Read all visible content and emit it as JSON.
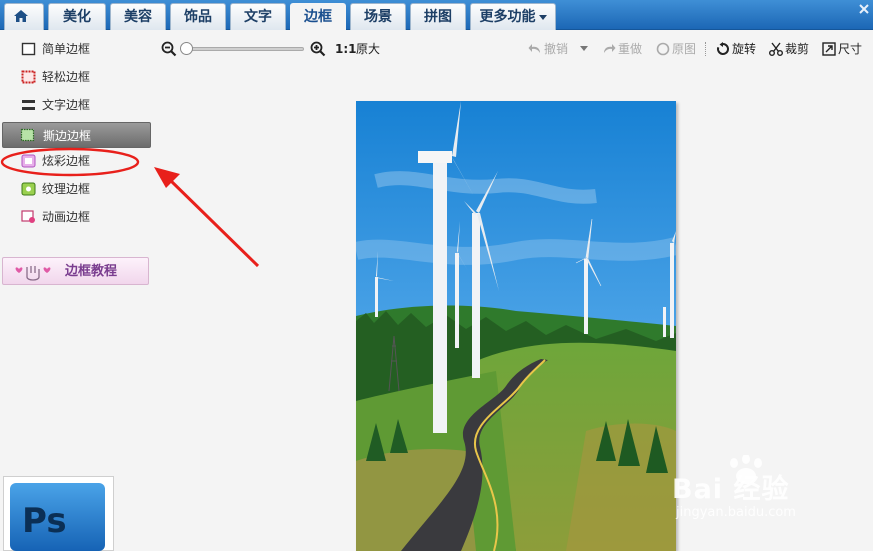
{
  "nav": {
    "tabs": [
      {
        "label": "美化",
        "active": false
      },
      {
        "label": "美容",
        "active": false
      },
      {
        "label": "饰品",
        "active": false
      },
      {
        "label": "文字",
        "active": false
      },
      {
        "label": "边框",
        "active": true
      },
      {
        "label": "场景",
        "active": false
      },
      {
        "label": "拼图",
        "active": false
      },
      {
        "label": "更多功能",
        "active": false,
        "has_dropdown": true
      }
    ],
    "home_icon": "home-icon"
  },
  "sidebar": {
    "items": [
      {
        "label": "简单边框",
        "icon": "simple-frame-icon",
        "selected": false
      },
      {
        "label": "轻松边框",
        "icon": "easy-frame-icon",
        "selected": false
      },
      {
        "label": "文字边框",
        "icon": "text-frame-icon",
        "selected": false
      },
      {
        "label": "撕边边框",
        "icon": "torn-edge-frame-icon",
        "selected": true
      },
      {
        "label": "炫彩边框",
        "icon": "dazzle-frame-icon",
        "selected": false,
        "highlighted": true
      },
      {
        "label": "纹理边框",
        "icon": "texture-frame-icon",
        "selected": false
      },
      {
        "label": "动画边框",
        "icon": "animation-frame-icon",
        "selected": false
      }
    ],
    "tutorial_button": "边框教程"
  },
  "toolbar": {
    "zoom_ratio": "1:1",
    "original_size": "原大",
    "undo": "撤销",
    "redo": "重做",
    "original_image": "原图",
    "rotate": "旋转",
    "crop": "裁剪",
    "size": "尺寸",
    "zoom_level_fraction": 0.0
  },
  "ps_panel": {
    "logo_text": "Ps"
  },
  "watermark": {
    "brand": "Bai 经验",
    "url": "jingyan.baidu.com"
  },
  "colors": {
    "nav_bg": "#2a78c4",
    "selected_item": "#7f7f7f",
    "annotation_red": "#e8201b",
    "tutorial_text": "#7a3d8f"
  }
}
